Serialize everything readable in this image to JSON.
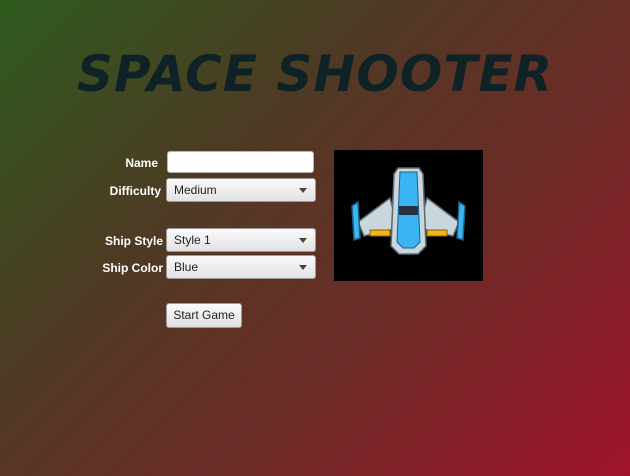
{
  "game": {
    "title": "SPACE SHOOTER"
  },
  "form": {
    "name_label": "Name",
    "name_value": "",
    "difficulty_label": "Difficulty",
    "difficulty_value": "Medium",
    "ship_style_label": "Ship Style",
    "ship_style_value": "Style 1",
    "ship_color_label": "Ship Color",
    "ship_color_value": "Blue",
    "start_button": "Start Game"
  },
  "preview": {
    "ship_icon": "spaceship-icon",
    "ship_color_hex": "#3ab4f2"
  },
  "colors": {
    "title": "#0f2226",
    "gradient_start": "#2f5a1e",
    "gradient_end": "#a0142a"
  }
}
